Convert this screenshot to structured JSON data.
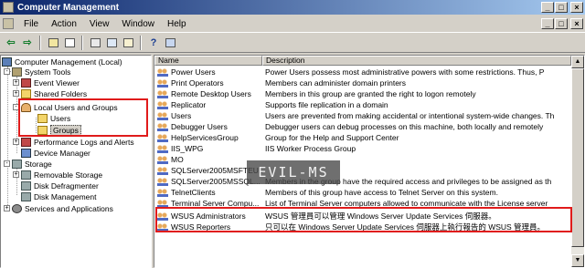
{
  "window": {
    "title": "Computer Management"
  },
  "menu": {
    "items": [
      "File",
      "Action",
      "View",
      "Window",
      "Help"
    ]
  },
  "controls": {
    "minimize": "_",
    "maximize": "□",
    "close": "×",
    "restore": "ð"
  },
  "tree": {
    "root": "Computer Management (Local)",
    "system_tools": "System Tools",
    "event_viewer": "Event Viewer",
    "shared_folders": "Shared Folders",
    "local_users_groups": "Local Users and Groups",
    "users": "Users",
    "groups": "Groups",
    "perf_logs": "Performance Logs and Alerts",
    "device_manager": "Device Manager",
    "storage": "Storage",
    "removable_storage": "Removable Storage",
    "disk_defrag": "Disk Defragmenter",
    "disk_mgmt": "Disk Management",
    "services_apps": "Services and Applications",
    "expand_plus": "+",
    "expand_minus": "-"
  },
  "list": {
    "columns": [
      "Name",
      "Description"
    ],
    "rows": [
      {
        "name": "Power Users",
        "desc": "Power Users possess most administrative powers with some restrictions.  Thus, P"
      },
      {
        "name": "Print Operators",
        "desc": "Members can administer domain printers"
      },
      {
        "name": "Remote Desktop Users",
        "desc": "Members in this group are granted the right to logon remotely"
      },
      {
        "name": "Replicator",
        "desc": "Supports file replication in a domain"
      },
      {
        "name": "Users",
        "desc": "Users are prevented from making accidental or intentional system-wide changes.  Th"
      },
      {
        "name": "Debugger Users",
        "desc": "Debugger users can debug processes on this machine, both locally and remotely"
      },
      {
        "name": "HelpServicesGroup",
        "desc": "Group for the Help and Support Center"
      },
      {
        "name": "IIS_WPG",
        "desc": "IIS Worker Process Group"
      },
      {
        "name": "MO",
        "desc": ""
      },
      {
        "name": "SQLServer2005MSFTEU...",
        "desc": ""
      },
      {
        "name": "SQLServer2005MSSQL...",
        "desc": "Members in the group have the required access and privileges to be assigned as th"
      },
      {
        "name": "TelnetClients",
        "desc": "Members of this group have access to Telnet Server on this system."
      },
      {
        "name": "Terminal Server Compu...",
        "desc": "List of Terminal Server computers allowed to communicate with the License server"
      },
      {
        "name": "WSUS Administrators",
        "desc": "WSUS 管理員可以管理 Windows Server Update Services 伺服器。"
      },
      {
        "name": "WSUS Reporters",
        "desc": "只可以在 Windows Server Update Services 伺服器上執行報告的 WSUS 管理員。"
      }
    ]
  },
  "scroll": {
    "up": "▲",
    "down": "▼"
  },
  "watermark": "EVIL-MS",
  "colors": {
    "highlight": "#e01b1b",
    "titlebar": "#0a246a"
  }
}
